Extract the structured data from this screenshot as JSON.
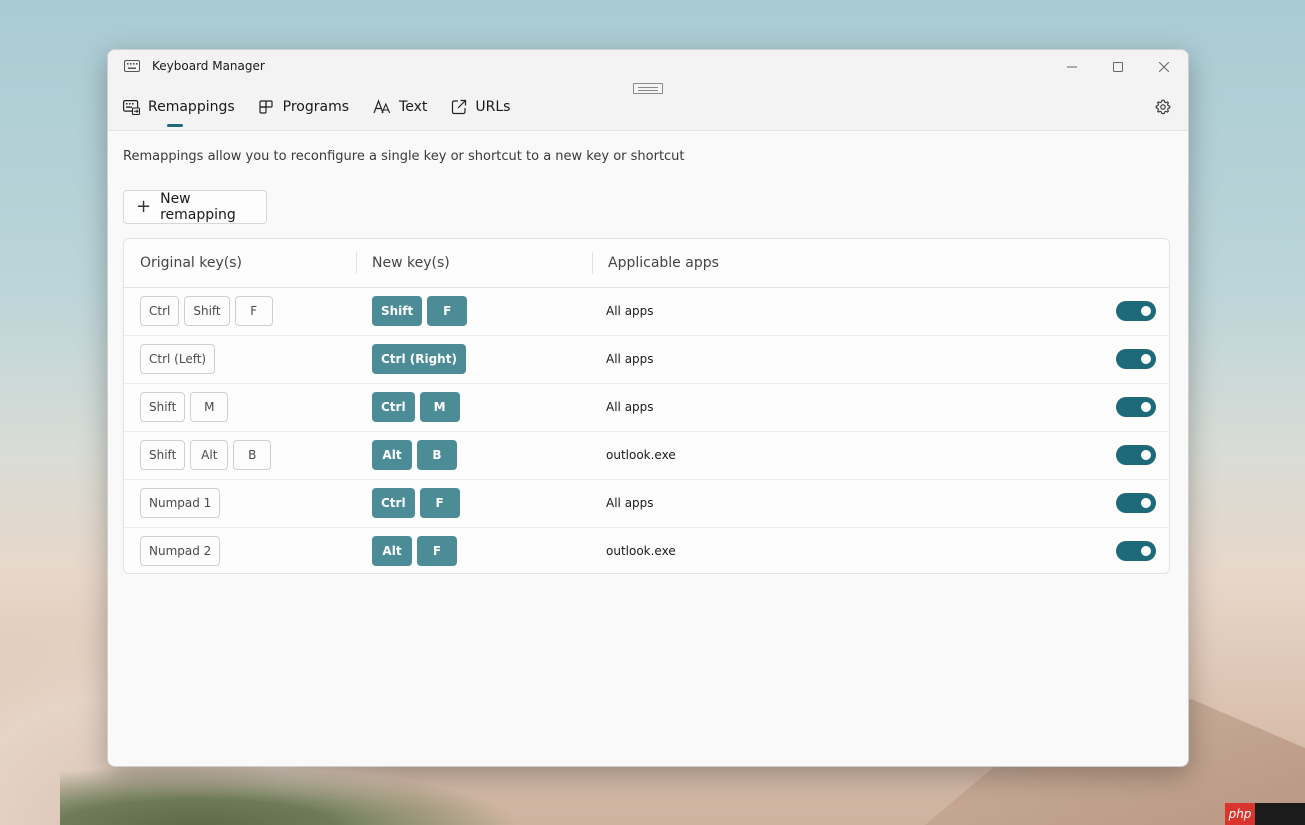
{
  "window": {
    "title": "Keyboard Manager",
    "min_icon": "minimize-icon",
    "max_icon": "maximize-icon",
    "close_icon": "close-icon"
  },
  "tabs": [
    {
      "label": "Remappings",
      "icon": "keyboard-remap-icon",
      "selected": true
    },
    {
      "label": "Programs",
      "icon": "programs-icon",
      "selected": false
    },
    {
      "label": "Text",
      "icon": "text-icon",
      "selected": false
    },
    {
      "label": "URLs",
      "icon": "url-icon",
      "selected": false
    }
  ],
  "settings_icon": "gear-icon",
  "description": "Remappings allow you to reconfigure a single key or shortcut to a new key or shortcut",
  "new_button": {
    "label": "New remapping",
    "icon": "plus-icon"
  },
  "table": {
    "headers": [
      "Original key(s)",
      "New key(s)",
      "Applicable apps"
    ],
    "rows": [
      {
        "original": [
          "Ctrl",
          "Shift",
          "F"
        ],
        "new": [
          "Shift",
          "F"
        ],
        "apps": "All apps",
        "enabled": true
      },
      {
        "original": [
          "Ctrl (Left)"
        ],
        "new": [
          "Ctrl (Right)"
        ],
        "apps": "All apps",
        "enabled": true
      },
      {
        "original": [
          "Shift",
          "M"
        ],
        "new": [
          "Ctrl",
          "M"
        ],
        "apps": "All apps",
        "enabled": true
      },
      {
        "original": [
          "Shift",
          "Alt",
          "B"
        ],
        "new": [
          "Alt",
          "B"
        ],
        "apps": "outlook.exe",
        "enabled": true
      },
      {
        "original": [
          "Numpad 1"
        ],
        "new": [
          "Ctrl",
          "F"
        ],
        "apps": "All apps",
        "enabled": true
      },
      {
        "original": [
          "Numpad 2"
        ],
        "new": [
          "Alt",
          "F"
        ],
        "apps": "outlook.exe",
        "enabled": true
      }
    ]
  },
  "colors": {
    "accent": "#1f6a7a",
    "new_key_fill": "#4b8c96"
  },
  "watermark": "php"
}
